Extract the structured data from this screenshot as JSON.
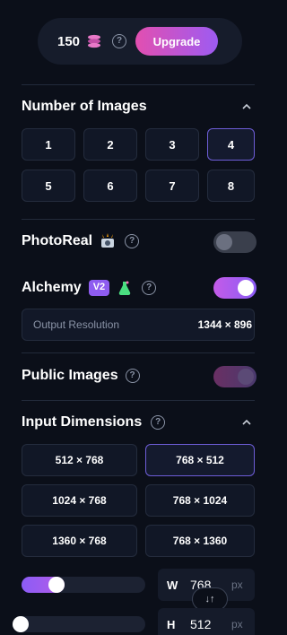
{
  "tokens": {
    "count": "150",
    "icon": "coin-stack-icon"
  },
  "upgrade": {
    "label": "Upgrade"
  },
  "help_glyph": "?",
  "number_of_images": {
    "title": "Number of Images",
    "options": [
      "1",
      "2",
      "3",
      "4",
      "5",
      "6",
      "7",
      "8"
    ],
    "selected": "4"
  },
  "photoreal": {
    "label": "PhotoReal",
    "icon": "camera-flash-icon",
    "enabled": false
  },
  "alchemy": {
    "label": "Alchemy",
    "badge": "V2",
    "icon": "potion-flask-icon",
    "enabled": true
  },
  "output_resolution": {
    "label": "Output Resolution",
    "value": "1344 × 896"
  },
  "public_images": {
    "label": "Public Images",
    "enabled": true
  },
  "input_dimensions": {
    "title": "Input Dimensions",
    "options": [
      "512 × 768",
      "768 × 512",
      "1024 × 768",
      "768 × 1024",
      "1360 × 768",
      "768 × 1360"
    ],
    "selected": "768 × 512"
  },
  "width_field": {
    "letter": "W",
    "value": "768",
    "unit": "px",
    "slider_fraction": 0.25
  },
  "height_field": {
    "letter": "H",
    "value": "512",
    "unit": "px",
    "slider_fraction": 0.0
  },
  "swap": {
    "label": "↓↑"
  },
  "colors": {
    "accent_purple": "#8b5cf6",
    "accent_pink": "#e24fb0",
    "background": "#0b0f19"
  }
}
